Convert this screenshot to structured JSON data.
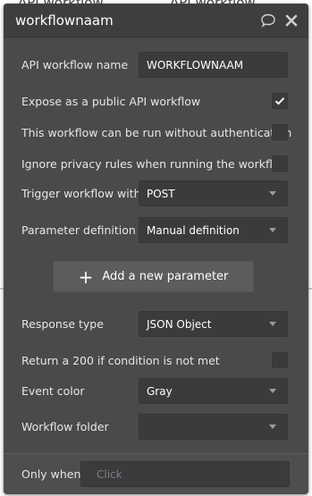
{
  "background": {
    "peek_texts": [
      "API workflow",
      "API workflow"
    ]
  },
  "header": {
    "title": "workflownaam",
    "comment_icon": "speech-bubble-icon",
    "close_icon": "close-icon"
  },
  "fields": {
    "api_workflow_name": {
      "label": "API workflow name",
      "value": "WORKFLOWNAAM"
    },
    "expose_public": {
      "label": "Expose as a public API workflow",
      "checked": true
    },
    "no_auth": {
      "label": "This workflow can be run without authentication",
      "checked": false
    },
    "ignore_privacy": {
      "label": "Ignore privacy rules when running the workflow",
      "checked": false
    },
    "trigger_with": {
      "label": "Trigger workflow with",
      "value": "POST"
    },
    "parameter_definition": {
      "label": "Parameter definition",
      "value": "Manual definition"
    },
    "add_parameter": {
      "label": "Add a new parameter"
    },
    "response_type": {
      "label": "Response type",
      "value": "JSON Object"
    },
    "return_200": {
      "label": "Return a 200 if condition is not met",
      "checked": false
    },
    "event_color": {
      "label": "Event color",
      "value": "Gray"
    },
    "workflow_folder": {
      "label": "Workflow folder",
      "value": ""
    },
    "only_when": {
      "label": "Only when",
      "placeholder": "Click"
    }
  },
  "colors": {
    "panel_bg": "#494a4c",
    "header_bg": "#3d3e40",
    "input_bg": "#3a3b3d",
    "button_bg": "#5b5c5e",
    "text": "#e6e6e6"
  }
}
